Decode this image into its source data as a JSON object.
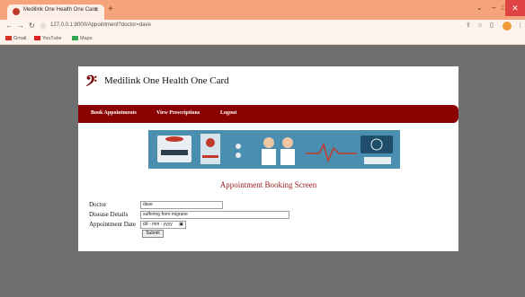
{
  "browser": {
    "tab_title": "Medilink One Health One Card",
    "url": "127.0.0.1:8000/Appointment?doctor=dave",
    "bookmarks": [
      "Gmail",
      "YouTube",
      "Maps"
    ]
  },
  "page": {
    "brand": "Medilink One Health One Card",
    "nav": [
      "Book Appointments",
      "View Prescriptions",
      "Logout"
    ],
    "heading": "Appointment Booking Screen"
  },
  "form": {
    "doctor_label": "Doctor",
    "doctor_value": "dave",
    "disease_label": "Disease Details",
    "disease_value": "suffering from migrane",
    "date_label": "Appointment Date",
    "date_placeholder": "dd - mm - yyyy",
    "submit_label": "Submit"
  },
  "colors": {
    "navbar": "#8b0000",
    "heading": "#9b1c1c",
    "background": "#6f6f6f"
  }
}
